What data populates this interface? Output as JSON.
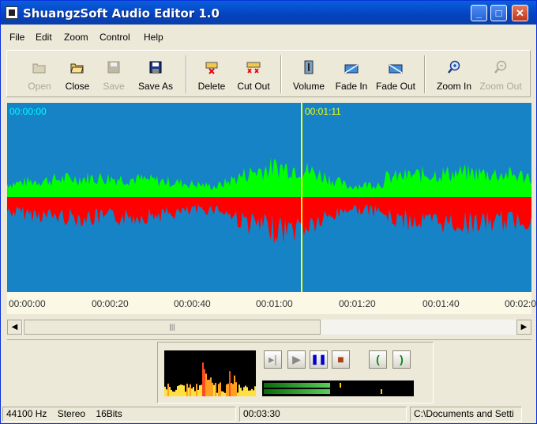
{
  "window": {
    "title": "ShuangzSoft Audio Editor 1.0"
  },
  "menu": [
    "File",
    "Edit",
    "Zoom",
    "Control",
    "Help"
  ],
  "toolbar": [
    {
      "label": "Open",
      "icon": "open-folder-icon",
      "enabled": false
    },
    {
      "label": "Close",
      "icon": "close-folder-icon",
      "enabled": true
    },
    {
      "label": "Save",
      "icon": "floppy-disk-icon",
      "enabled": false
    },
    {
      "label": "Save As",
      "icon": "floppy-disk-icon",
      "enabled": true
    },
    {
      "label": "Delete",
      "icon": "delete-icon",
      "enabled": true
    },
    {
      "label": "Cut Out",
      "icon": "cut-out-icon",
      "enabled": true
    },
    {
      "label": "Volume",
      "icon": "volume-icon",
      "enabled": true
    },
    {
      "label": "Fade In",
      "icon": "fade-in-icon",
      "enabled": true
    },
    {
      "label": "Fade Out",
      "icon": "fade-out-icon",
      "enabled": true
    },
    {
      "label": "Zoom In",
      "icon": "zoom-in-icon",
      "enabled": true
    },
    {
      "label": "Zoom Out",
      "icon": "zoom-out-icon",
      "enabled": false
    }
  ],
  "waveform": {
    "start_time": "00:00:00",
    "cursor_time": "00:01:11",
    "background": "#1583c6",
    "upper_color": "#00ff00",
    "lower_color": "#ff0000",
    "cursor_color": "#ffff00"
  },
  "ruler": [
    "00:00:00",
    "00:00:20",
    "00:00:40",
    "00:01:00",
    "00:01:20",
    "00:01:40",
    "00:02:0"
  ],
  "transport": {
    "buttons": [
      {
        "name": "play-from-start-button",
        "glyph": "⏵"
      },
      {
        "name": "play-button",
        "glyph": "▶"
      },
      {
        "name": "pause-button",
        "glyph": "❚❚"
      },
      {
        "name": "stop-button",
        "glyph": "■"
      },
      {
        "name": "mark-start-button",
        "glyph": "("
      },
      {
        "name": "mark-end-button",
        "glyph": ")"
      }
    ]
  },
  "status": {
    "format": "44100 Hz    Stereo    16Bits",
    "duration": "00:03:30",
    "path": "C:\\Documents and Setti"
  }
}
